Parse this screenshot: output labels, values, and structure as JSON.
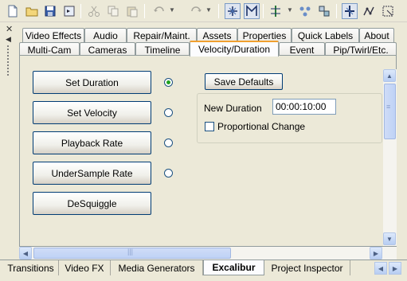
{
  "toolbar": {
    "icons": [
      "new-file-icon",
      "open-folder-icon",
      "save-icon",
      "properties-icon",
      "cut-icon",
      "copy-icon",
      "paste-icon",
      "undo-icon",
      "redo-icon",
      "snapping-icon",
      "markers-icon",
      "trim-icon",
      "insert-icon",
      "group-icon",
      "track-motion-icon",
      "envelope-icon",
      "crop-select-icon"
    ]
  },
  "tabs_row1": [
    "Video Effects",
    "Audio",
    "Repair/Maint.",
    "Assets",
    "Properties",
    "Quick Labels",
    "About"
  ],
  "tabs_row2": [
    "Multi-Cam",
    "Cameras",
    "Timeline",
    "Velocity/Duration",
    "Event",
    "Pip/Twirl/Etc."
  ],
  "active_tab": "Velocity/Duration",
  "panel": {
    "buttons": {
      "set_duration": "Set Duration",
      "set_velocity": "Set Velocity",
      "playback_rate": "Playback Rate",
      "undersample_rate": "UnderSample Rate",
      "desquiggle": "DeSquiggle",
      "save_defaults": "Save Defaults"
    },
    "selected_mode": "Set Duration",
    "new_duration_label": "New Duration",
    "new_duration_value": "00:00:10:00",
    "proportional_change_label": "Proportional Change",
    "proportional_change_checked": false
  },
  "bottom_tabs": [
    "Transitions",
    "Video FX",
    "Media Generators",
    "Excalibur",
    "Project Inspector"
  ],
  "active_bottom_tab": "Excalibur",
  "colors": {
    "active_tab_accent": "#f0a030",
    "button_border": "#003c74",
    "radio_dot": "#21a121",
    "scroll_blue": "#bfd2f6"
  }
}
